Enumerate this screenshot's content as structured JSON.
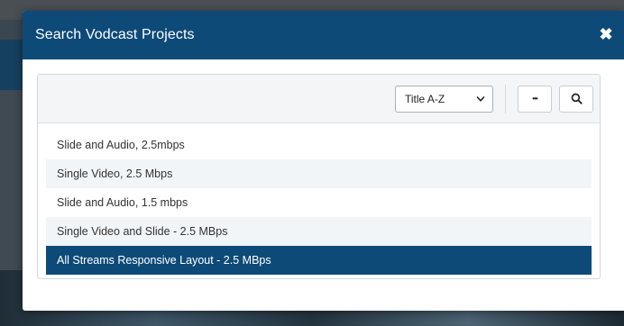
{
  "modal": {
    "title": "Search Vodcast Projects",
    "close_label": "✖"
  },
  "toolbar": {
    "sort_selected": "Title A-Z",
    "more_label": "•••"
  },
  "results": [
    {
      "label": "Slide and Audio, 2.5mbps",
      "selected": false
    },
    {
      "label": "Single Video, 2.5 Mbps",
      "selected": false
    },
    {
      "label": "Slide and Audio, 1.5 mbps",
      "selected": false
    },
    {
      "label": "Single Video and Slide - 2.5 MBps",
      "selected": false
    },
    {
      "label": "All Streams Responsive Layout - 2.5 MBps",
      "selected": true
    }
  ],
  "colors": {
    "header": "#0e4a78",
    "selected_row": "#0e4a78",
    "alt_row": "#f2f5f8"
  },
  "icons": {
    "close": "close-icon",
    "sort_dropdown": "chevron-down-icon",
    "more": "ellipsis-icon",
    "search": "search-icon"
  }
}
